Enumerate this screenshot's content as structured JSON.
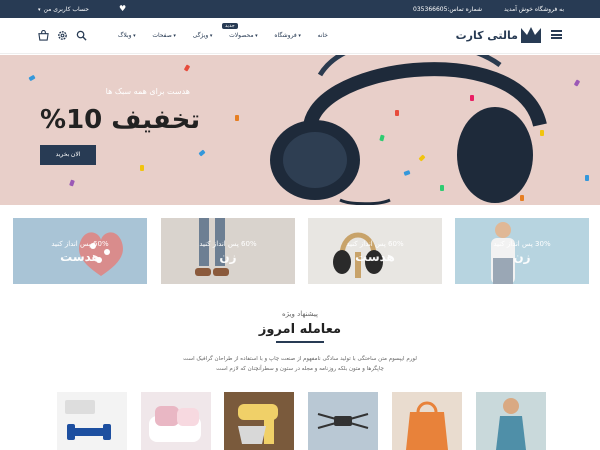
{
  "topbar": {
    "welcome": "به فروشگاه خوش آمدید",
    "phone": "شماره تماس:035366605",
    "account": "حساب کاربری من"
  },
  "header": {
    "logo_text": "مالتی کارت",
    "nav": [
      {
        "label": "خانه",
        "dropdown": false
      },
      {
        "label": "فروشگاه",
        "dropdown": true
      },
      {
        "label": "محصولات",
        "dropdown": true
      },
      {
        "label": "ویژگی",
        "dropdown": true
      },
      {
        "label": "صفحات",
        "dropdown": true
      },
      {
        "label": "وبلاگ",
        "dropdown": true
      }
    ],
    "nav_badge": "جدید",
    "icons": [
      "search-icon",
      "gear-icon",
      "cart-icon"
    ]
  },
  "hero": {
    "subtitle": "هدست برای همه سبک ها",
    "title": "تخفیف 10%",
    "button": "الان بخرید"
  },
  "categories": [
    {
      "line1": "30% پس انداز کنید",
      "line2": "زن"
    },
    {
      "line1": "60% پس انداز کنید",
      "line2": "هدست"
    },
    {
      "line1": "60% پس انداز کنید",
      "line2": "زن"
    },
    {
      "line1": "60% پس انداز کنید",
      "line2": "هدست"
    }
  ],
  "deal": {
    "subtitle": "پیشنهاد ویژه",
    "title": "معامله امروز",
    "description": "لورم ایپسوم متن ساختگی با تولید سادگی نامفهوم از صنعت چاپ و با استفاده از طراحان گرافیک است چاپگرها و متون بلکه روزنامه و مجله در ستون و سطرآنچنان که لازم است"
  },
  "products": [
    "woman-model",
    "shopping-bag",
    "drone",
    "stand-mixer",
    "pillows",
    "dumbbells"
  ],
  "colors": {
    "primary": "#283b54",
    "hero_bg": "#e8cfc9"
  }
}
